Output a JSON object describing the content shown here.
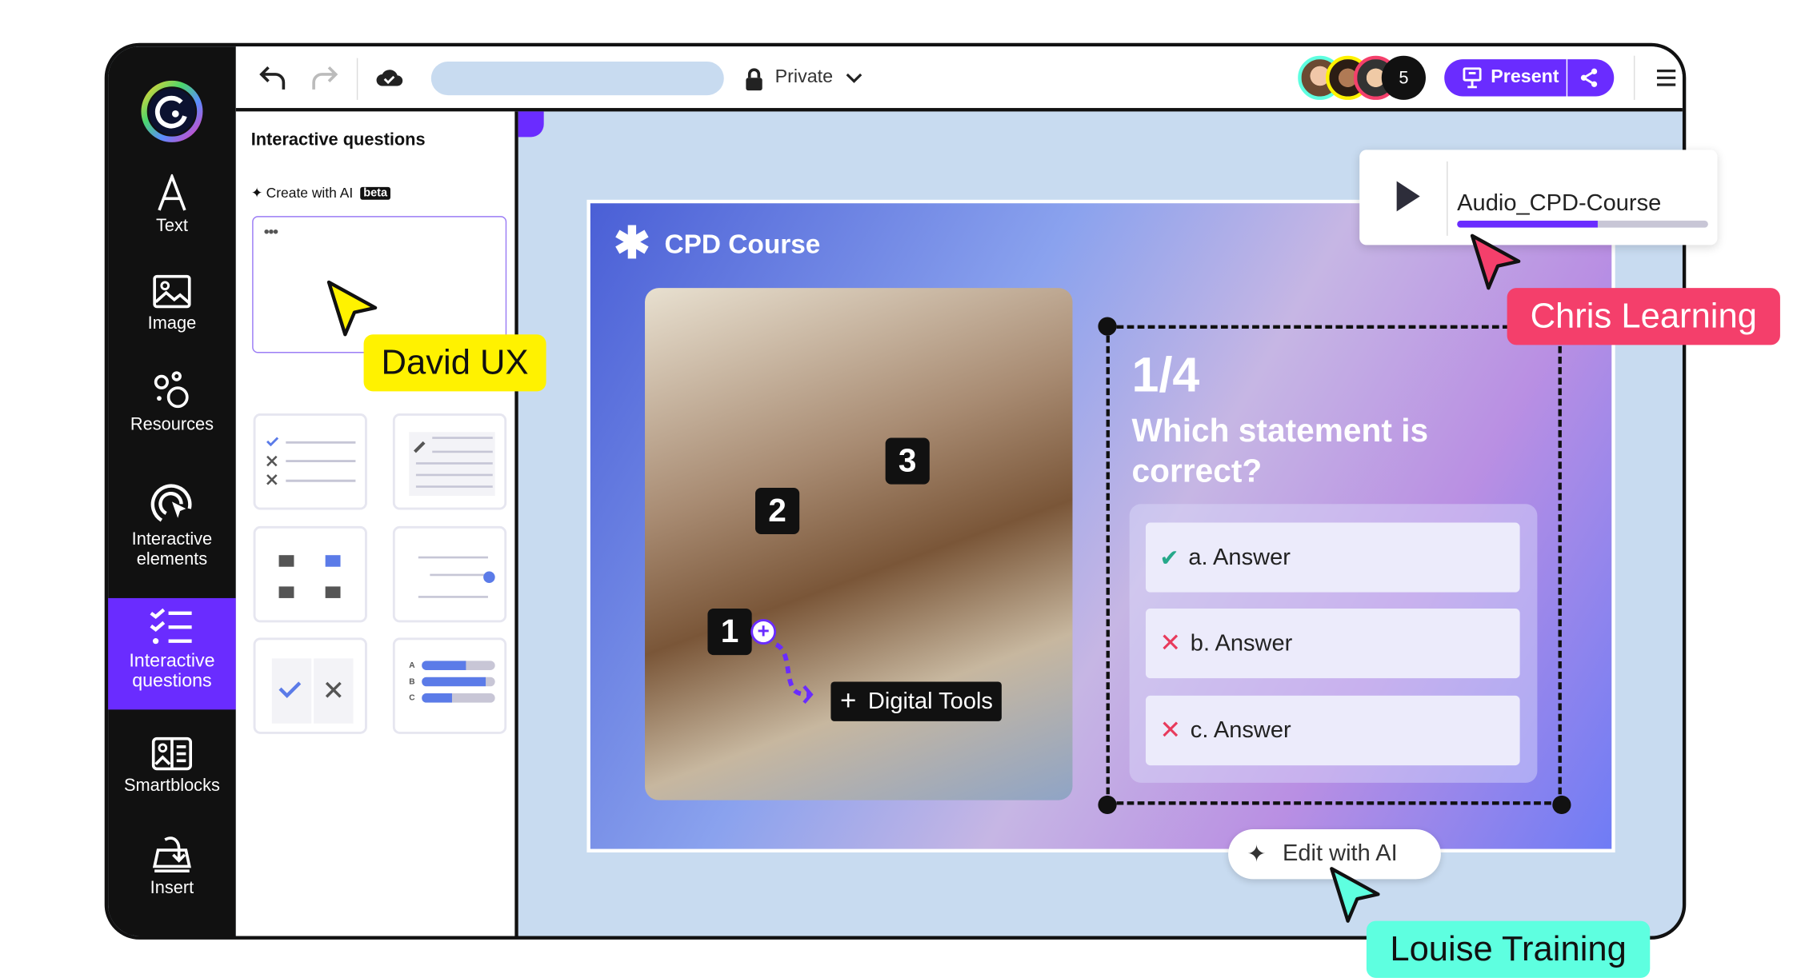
{
  "sidebar": {
    "items": [
      {
        "label": "Text",
        "icon": "text-icon"
      },
      {
        "label": "Image",
        "icon": "image-icon"
      },
      {
        "label": "Resources",
        "icon": "resources-icon"
      },
      {
        "label": "Interactive elements",
        "icon": "interactive-elements-icon"
      },
      {
        "label": "Interactive questions",
        "icon": "checklist-icon",
        "active": true
      },
      {
        "label": "Smartblocks",
        "icon": "smartblocks-icon"
      },
      {
        "label": "Insert",
        "icon": "insert-icon"
      }
    ]
  },
  "toolbar": {
    "visibility": "Private",
    "collaborator_count": "5",
    "present_label": "Present"
  },
  "panel": {
    "title": "Interactive questions",
    "create_ai": "Create with AI",
    "beta": "beta",
    "more": "•••"
  },
  "slide": {
    "title": "CPD Course",
    "hotspots": [
      "1",
      "2",
      "3"
    ],
    "hotspot_label": "Digital Tools",
    "counter": "1/4",
    "question": "Which statement is correct?",
    "answers": [
      {
        "text": "a. Answer",
        "correct": true
      },
      {
        "text": "b. Answer",
        "correct": false
      },
      {
        "text": "c. Answer",
        "correct": false
      }
    ],
    "quiz_bars": [
      "A",
      "B",
      "C"
    ],
    "quiz_bar_fill": [
      0.6,
      0.88,
      0.42
    ]
  },
  "audio": {
    "name": "Audio_CPD-Course",
    "progress": 0.56
  },
  "edit_ai": "Edit with AI",
  "cursors": [
    {
      "name": "David UX",
      "color": "#fff200"
    },
    {
      "name": "Chris Learning",
      "color": "#f43f6b"
    },
    {
      "name": "Louise Training",
      "color": "#5effe0"
    }
  ],
  "colors": {
    "accent": "#6a2cff",
    "canvas": "#c8dbf0",
    "sidebar": "#111111"
  }
}
